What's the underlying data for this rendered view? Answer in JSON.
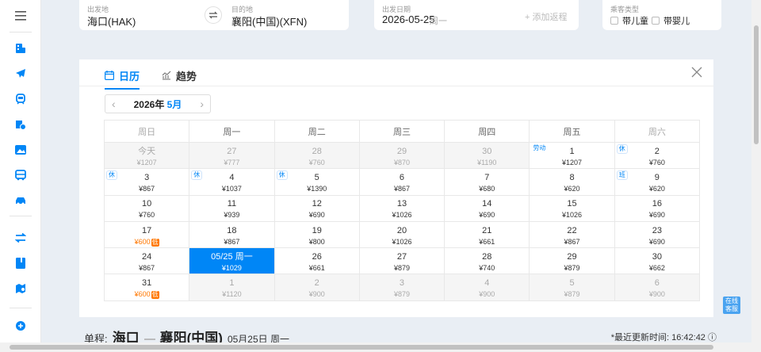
{
  "search": {
    "from_label": "出发地",
    "from_value": "海口(HAK)",
    "to_label": "目的地",
    "to_value": "襄阳(中国)(XFN)",
    "date_label": "出发日期",
    "date_value": "2026-05-25",
    "date_weekday": "周一",
    "add_return": "+ 添加返程",
    "passenger_label": "乘客类型",
    "child": "带儿童",
    "infant": "带婴儿"
  },
  "tabs": {
    "calendar": "日历",
    "trend": "趋势"
  },
  "month_nav": {
    "year": "2026年",
    "month": "5月"
  },
  "weekdays": [
    "周日",
    "周一",
    "周二",
    "周三",
    "周四",
    "周五",
    "周六"
  ],
  "weeks": [
    [
      {
        "d": "今天",
        "p": "¥1207",
        "dim": true
      },
      {
        "d": "27",
        "p": "¥777",
        "dim": true
      },
      {
        "d": "28",
        "p": "¥760",
        "dim": true
      },
      {
        "d": "29",
        "p": "¥870",
        "dim": true
      },
      {
        "d": "30",
        "p": "¥1190",
        "dim": true
      },
      {
        "d": "1",
        "p": "¥1207",
        "flag": "劳动",
        "flag_plain": true
      },
      {
        "d": "2",
        "p": "¥760",
        "flag": "休"
      }
    ],
    [
      {
        "d": "3",
        "p": "¥867",
        "flag": "休"
      },
      {
        "d": "4",
        "p": "¥1037",
        "flag": "休"
      },
      {
        "d": "5",
        "p": "¥1390",
        "flag": "休"
      },
      {
        "d": "6",
        "p": "¥867"
      },
      {
        "d": "7",
        "p": "¥680"
      },
      {
        "d": "8",
        "p": "¥620"
      },
      {
        "d": "9",
        "p": "¥620",
        "flag": "班"
      }
    ],
    [
      {
        "d": "10",
        "p": "¥760"
      },
      {
        "d": "11",
        "p": "¥939"
      },
      {
        "d": "12",
        "p": "¥690"
      },
      {
        "d": "13",
        "p": "¥1026"
      },
      {
        "d": "14",
        "p": "¥690"
      },
      {
        "d": "15",
        "p": "¥1026"
      },
      {
        "d": "16",
        "p": "¥690"
      }
    ],
    [
      {
        "d": "17",
        "p": "¥600",
        "low": "低"
      },
      {
        "d": "18",
        "p": "¥867"
      },
      {
        "d": "19",
        "p": "¥800"
      },
      {
        "d": "20",
        "p": "¥1026"
      },
      {
        "d": "21",
        "p": "¥661"
      },
      {
        "d": "22",
        "p": "¥867"
      },
      {
        "d": "23",
        "p": "¥690"
      }
    ],
    [
      {
        "d": "24",
        "p": "¥867"
      },
      {
        "d": "05/25 周一",
        "p": "¥1029",
        "sel": true
      },
      {
        "d": "26",
        "p": "¥661"
      },
      {
        "d": "27",
        "p": "¥879"
      },
      {
        "d": "28",
        "p": "¥740"
      },
      {
        "d": "29",
        "p": "¥879"
      },
      {
        "d": "30",
        "p": "¥662"
      }
    ],
    [
      {
        "d": "31",
        "p": "¥600",
        "low": "低"
      },
      {
        "d": "1",
        "p": "¥1120",
        "dim": true
      },
      {
        "d": "2",
        "p": "¥900",
        "dim": true
      },
      {
        "d": "3",
        "p": "¥879",
        "dim": true
      },
      {
        "d": "4",
        "p": "¥900",
        "dim": true
      },
      {
        "d": "5",
        "p": "¥879",
        "dim": true
      },
      {
        "d": "6",
        "p": "¥900",
        "dim": true
      }
    ]
  ],
  "bottom": {
    "prefix": "单程:",
    "from_city": "海口",
    "to_city": "襄阳(中国)",
    "date": "05月25日 周一",
    "update_label": "*最近更新时间: 16:42:42"
  },
  "customer_service": "在线客服",
  "colors": {
    "accent": "#0086f6",
    "low_price": "#ff7700"
  },
  "rail_icons": [
    "menu-icon",
    "hotel-icon",
    "flight-icon",
    "train-icon",
    "ticket-icon",
    "photo-icon",
    "bus-icon",
    "car-icon",
    "transfer-icon",
    "guide-icon",
    "map-icon",
    "gift-icon"
  ]
}
